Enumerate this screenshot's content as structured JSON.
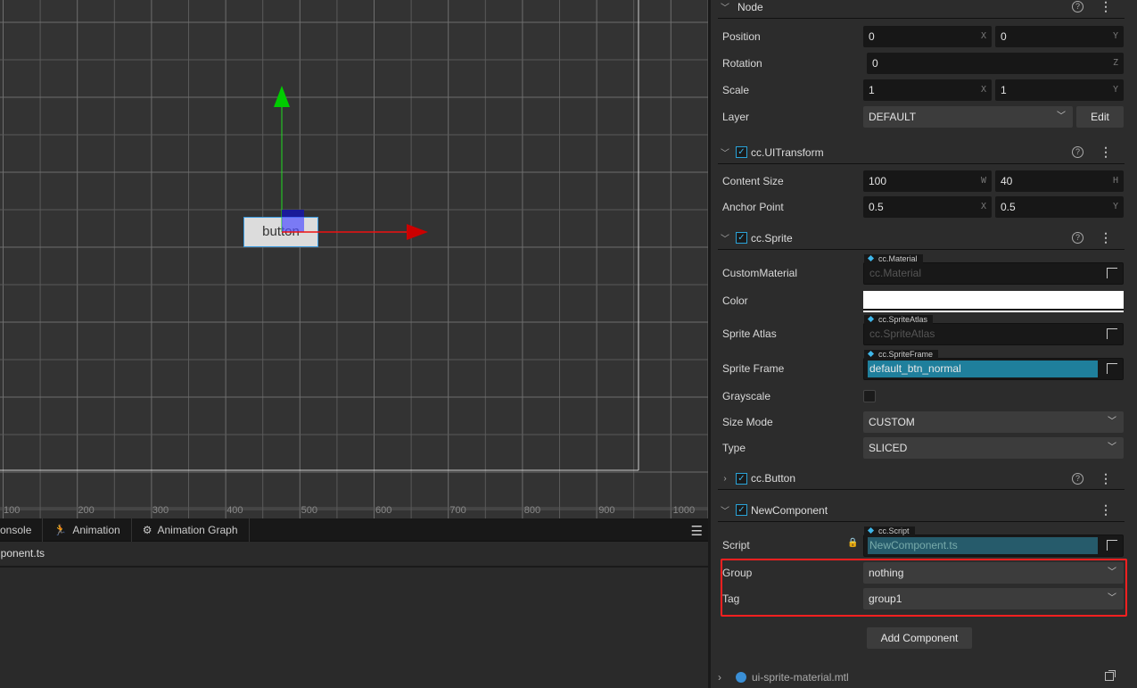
{
  "scene": {
    "button_text": "button",
    "ruler_labels": [
      "100",
      "200",
      "300",
      "400",
      "500",
      "600",
      "700",
      "800",
      "900",
      "1000"
    ]
  },
  "bottom_panel": {
    "tabs": [
      {
        "label": "onsole",
        "icon": ""
      },
      {
        "label": "Animation",
        "icon": "running-man-icon"
      },
      {
        "label": "Animation Graph",
        "icon": "animation-graph-icon"
      }
    ],
    "file": "nponent.ts"
  },
  "inspector": {
    "node": {
      "title": "Node",
      "position": {
        "label": "Position",
        "x": "0",
        "y": "0"
      },
      "rotation": {
        "label": "Rotation",
        "z": "0"
      },
      "scale": {
        "label": "Scale",
        "x": "1",
        "y": "1"
      },
      "layer": {
        "label": "Layer",
        "value": "DEFAULT",
        "edit": "Edit"
      }
    },
    "uitransform": {
      "title": "cc.UITransform",
      "enabled": true,
      "content_size": {
        "label": "Content Size",
        "w": "100",
        "h": "40"
      },
      "anchor": {
        "label": "Anchor Point",
        "x": "0.5",
        "y": "0.5"
      }
    },
    "sprite": {
      "title": "cc.Sprite",
      "enabled": true,
      "custom_material": {
        "label": "CustomMaterial",
        "type": "cc.Material",
        "placeholder": "cc.Material"
      },
      "color": {
        "label": "Color",
        "value": "#ffffff"
      },
      "sprite_atlas": {
        "label": "Sprite Atlas",
        "type": "cc.SpriteAtlas",
        "placeholder": "cc.SpriteAtlas"
      },
      "sprite_frame": {
        "label": "Sprite Frame",
        "type": "cc.SpriteFrame",
        "value": "default_btn_normal"
      },
      "grayscale": {
        "label": "Grayscale",
        "checked": false
      },
      "size_mode": {
        "label": "Size Mode",
        "value": "CUSTOM"
      },
      "type": {
        "label": "Type",
        "value": "SLICED"
      }
    },
    "button": {
      "title": "cc.Button",
      "enabled": true
    },
    "new_component": {
      "title": "NewComponent",
      "enabled": true,
      "script": {
        "label": "Script",
        "type": "cc.Script",
        "value": "NewComponent.ts"
      },
      "group": {
        "label": "Group",
        "value": "nothing"
      },
      "tag": {
        "label": "Tag",
        "value": "group1"
      }
    },
    "add_component": "Add Component",
    "material": {
      "title": "ui-sprite-material.mtl"
    },
    "axis_labels": {
      "x": "X",
      "y": "Y",
      "z": "Z",
      "w": "W",
      "h": "H"
    },
    "highlight_color": "#ff2020"
  }
}
